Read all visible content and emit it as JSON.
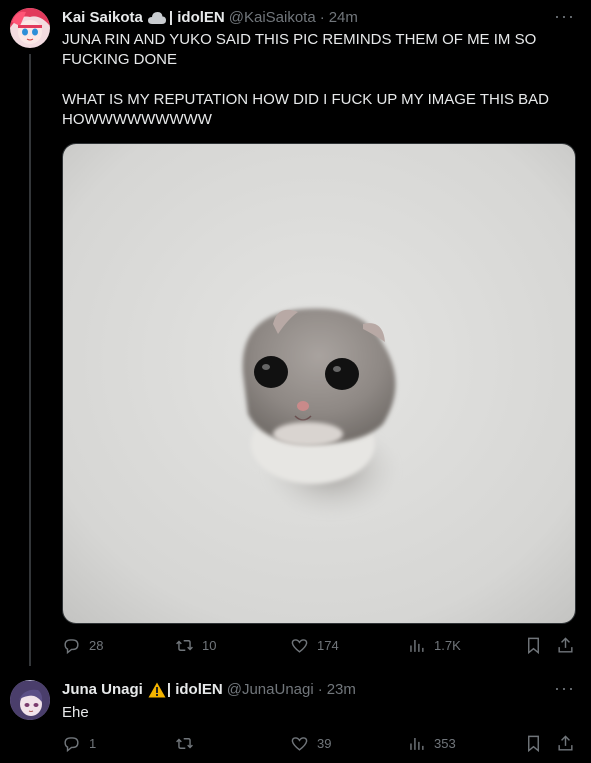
{
  "tweet1": {
    "name": "Kai Saikota",
    "org": "| idolEN",
    "handle": "@KaiSaikota",
    "time": "24m",
    "text": "JUNA RIN AND YUKO SAID THIS PIC REMINDS THEM OF ME IM SO FUCKING DONE\n\nWHAT IS MY REPUTATION HOW DID I FUCK UP MY IMAGE THIS BAD HOWWWWWWWWW",
    "replies": "28",
    "retweets": "10",
    "likes": "174",
    "views": "1.7K"
  },
  "tweet2": {
    "name": "Juna Unagi",
    "org": "| idolEN",
    "handle": "@JunaUnagi",
    "time": "23m",
    "text": "Ehe",
    "replies": "1",
    "retweets": "",
    "likes": "39",
    "views": "353"
  },
  "icons": [
    "cloud-emoji",
    "warning-emoji",
    "more-icon",
    "reply-icon",
    "retweet-icon",
    "like-icon",
    "views-icon",
    "bookmark-icon",
    "share-icon"
  ],
  "colors": {
    "background": "#000000",
    "text": "#e7e9ea",
    "muted": "#71767b",
    "divider": "#2f3336"
  }
}
